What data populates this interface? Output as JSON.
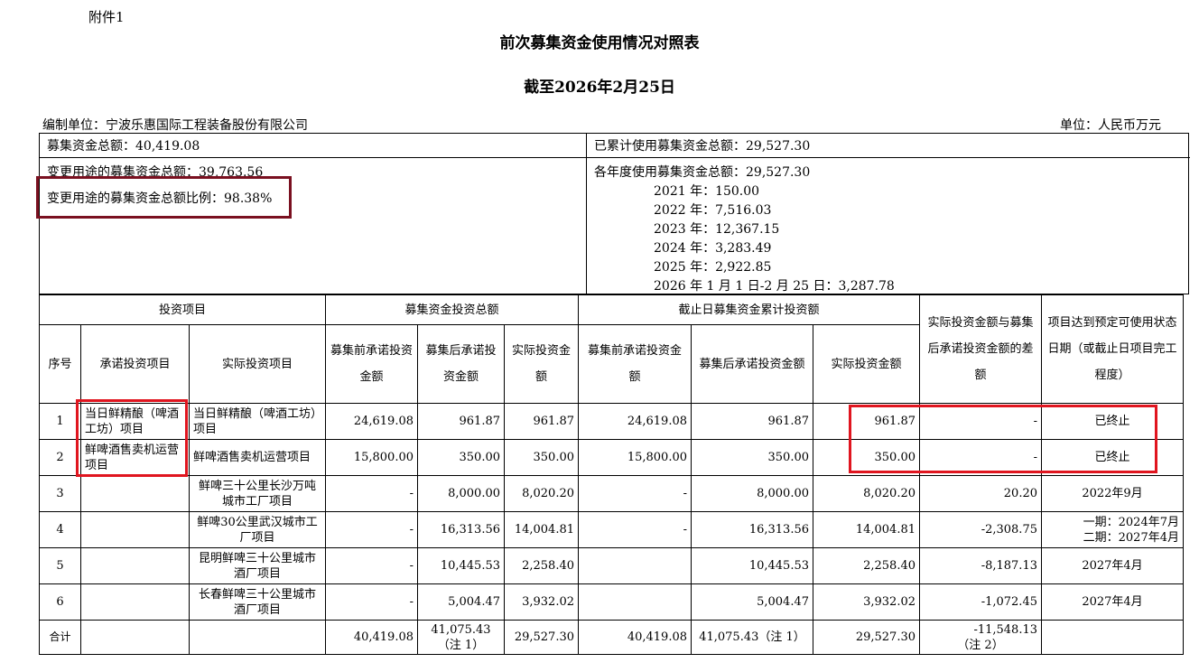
{
  "attachment_label": "附件1",
  "title": "前次募集资金使用情况对照表",
  "subtitle": "截至2026年2月25日",
  "compiler": "编制单位：宁波乐惠国际工程装备股份有限公司",
  "unit": "单位：人民币万元",
  "summary": {
    "total_raised": "募集资金总额：40,419.08",
    "cumulative_used": "已累计使用募集资金总额：29,527.30",
    "changed_total": "变更用途的募集资金总额：39,763.56",
    "changed_ratio": "变更用途的募集资金总额比例：98.38%",
    "yearly_header": "各年度使用募集资金总额：29,527.30",
    "yearly": [
      "2021 年：150.00",
      "2022 年：7,516.03",
      "2023 年：12,367.15",
      "2024 年：3,283.49",
      "2025 年：2,922.85",
      "2026 年 1 月 1 日-2 月 25 日：3,287.78"
    ]
  },
  "headers": {
    "investment_project": "投资项目",
    "total_investment": "募集资金投资总额",
    "cumulative_investment": "截止日募集资金累计投资额",
    "difference": "实际投资金额与募集后承诺投资金额的差额",
    "ready_date": "项目达到预定可使用状态日期（或截止日项目完工程度）",
    "seq": "序号",
    "promised_project": "承诺投资项目",
    "actual_project": "实际投资项目",
    "pre_promised": "募集前承诺投资金额",
    "post_promised": "募集后承诺投资金额",
    "actual_amount": "实际投资金额",
    "pre_promised_2": "募集前承诺投资金额",
    "post_promised_2": "募集后承诺投资金额",
    "actual_amount_2": "实际投资金额"
  },
  "rows": [
    {
      "seq": "1",
      "promised": "当日鲜精酿（啤酒工坊）项目",
      "actual": "当日鲜精酿（啤酒工坊）项目",
      "pre": "24,619.08",
      "post": "961.87",
      "act": "961.87",
      "pre2": "24,619.08",
      "post2": "961.87",
      "act2": "961.87",
      "diff": "-",
      "date": "已终止"
    },
    {
      "seq": "2",
      "promised": "鲜啤酒售卖机运营项目",
      "actual": "鲜啤酒售卖机运营项目",
      "pre": "15,800.00",
      "post": "350.00",
      "act": "350.00",
      "pre2": "15,800.00",
      "post2": "350.00",
      "act2": "350.00",
      "diff": "-",
      "date": "已终止"
    },
    {
      "seq": "3",
      "promised": "",
      "actual": "鲜啤三十公里长沙万吨城市工厂项目",
      "pre": "-",
      "post": "8,000.00",
      "act": "8,020.20",
      "pre2": "-",
      "post2": "8,000.00",
      "act2": "8,020.20",
      "diff": "20.20",
      "date": "2022年9月"
    },
    {
      "seq": "4",
      "promised": "",
      "actual": "鲜啤30公里武汉城市工厂项目",
      "pre": "-",
      "post": "16,313.56",
      "act": "14,004.81",
      "pre2": "-",
      "post2": "16,313.56",
      "act2": "14,004.81",
      "diff": "-2,308.75",
      "date": "一期：2024年7月",
      "date2": "二期：2027年4月"
    },
    {
      "seq": "5",
      "promised": "",
      "actual": "昆明鲜啤三十公里城市酒厂项目",
      "pre": "-",
      "post": "10,445.53",
      "act": "2,258.40",
      "pre2": "",
      "post2": "10,445.53",
      "act2": "2,258.40",
      "diff": "-8,187.13",
      "date": "2027年4月"
    },
    {
      "seq": "6",
      "promised": "",
      "actual": "长春鲜啤三十公里城市酒厂项目",
      "pre": "-",
      "post": "5,004.47",
      "act": "3,932.02",
      "pre2": "",
      "post2": "5,004.47",
      "act2": "3,932.02",
      "diff": "-1,072.45",
      "date": "2027年4月"
    }
  ],
  "total": {
    "label": "合计",
    "pre": "40,419.08",
    "post": "41,075.43",
    "post_note": "（注 1）",
    "act": "29,527.30",
    "pre2": "40,419.08",
    "post2": "41,075.43（注 1）",
    "act2": "29,527.30",
    "diff": "-11,548.13",
    "diff_note": "（注 2）"
  },
  "colors": {
    "highlight_red": "#e0151f",
    "highlight_dark": "#7a1020"
  }
}
